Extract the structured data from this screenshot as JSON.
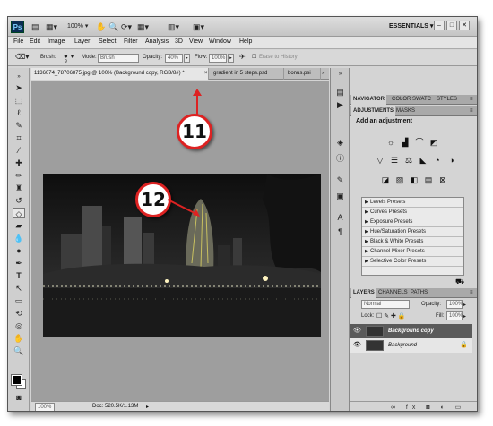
{
  "app": {
    "logo": "Ps",
    "zoom": "100%",
    "workspace": "ESSENTIALS",
    "window_buttons": [
      "–",
      "□",
      "✕"
    ]
  },
  "menu": [
    "File",
    "Edit",
    "Image",
    "Layer",
    "Select",
    "Filter",
    "Analysis",
    "3D",
    "View",
    "Window",
    "Help"
  ],
  "options": {
    "brush_label": "Brush:",
    "brush_size": "9",
    "mode_label": "Mode:",
    "mode_value": "Brush",
    "opacity_label": "Opacity:",
    "opacity_value": "40%",
    "flow_label": "Flow:",
    "flow_value": "100%",
    "erase_history": "Erase to History"
  },
  "tabs": [
    {
      "label": "1136074_78706875.jpg @ 100% (Background copy, RGB/8#) *"
    },
    {
      "label": "gradient in 5 steps.psd"
    },
    {
      "label": "bonus.psi"
    }
  ],
  "status": {
    "zoom": "100%",
    "doc": "Doc: 520.5K/1.13M"
  },
  "callouts": {
    "c11": "11",
    "c12": "12"
  },
  "panels": {
    "top_tabs": [
      "NAVIGATOR",
      "COLOR",
      "SWATC",
      "STYLES"
    ],
    "adj_tabs": [
      "ADJUSTMENTS",
      "MASKS"
    ],
    "adj_title": "Add an adjustment",
    "presets": [
      "Levels Presets",
      "Curves Presets",
      "Exposure Presets",
      "Hue/Saturation Presets",
      "Black & White Presets",
      "Channel Mixer Presets",
      "Selective Color Presets"
    ],
    "layer_tabs": [
      "LAYERS",
      "CHANNELS",
      "PATHS"
    ],
    "blend_mode": "Normal",
    "opacity_label": "Opacity:",
    "opacity_value": "100%",
    "lock_label": "Lock:",
    "fill_label": "Fill:",
    "fill_value": "100%",
    "layers": [
      {
        "name": "Background copy",
        "selected": true
      },
      {
        "name": "Background",
        "selected": false
      }
    ]
  },
  "colors": {
    "callout_border": "#d22222",
    "selected_layer": "#5a5a5a"
  }
}
